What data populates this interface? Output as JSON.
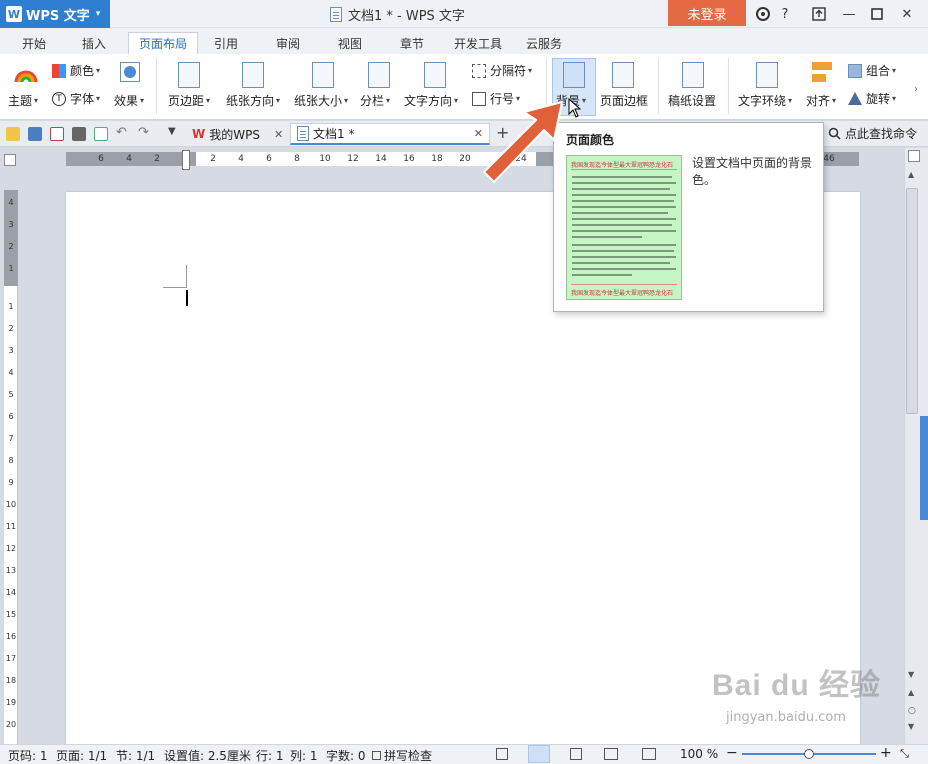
{
  "titlebar": {
    "app_name": "WPS 文字",
    "app_logo": "W",
    "doc_title": "文档1 * - WPS 文字",
    "login": "未登录",
    "skin_icon": "skin-icon",
    "help": "?",
    "minimize": "—",
    "close": "✕"
  },
  "tabs": [
    "开始",
    "插入",
    "页面布局",
    "引用",
    "审阅",
    "视图",
    "章节",
    "开发工具",
    "云服务"
  ],
  "active_tab": "页面布局",
  "ribbon": {
    "theme": "主题",
    "color": "颜色",
    "font": "字体",
    "effect": "效果",
    "margins": "页边距",
    "orientation": "纸张方向",
    "size": "纸张大小",
    "columns": "分栏",
    "text_direction": "文字方向",
    "separator": "分隔符",
    "line_number": "行号",
    "background": "背景",
    "page_border": "页面边框",
    "paper_settings": "稿纸设置",
    "text_wrap": "文字环绕",
    "align": "对齐",
    "group": "组合",
    "rotate": "旋转"
  },
  "qab": {
    "tab1": "我的WPS",
    "tab2": "文档1 *",
    "search": "点此查找命令",
    "add": "+"
  },
  "ruler": {
    "h_ticks": [
      "6",
      "4",
      "2",
      "2",
      "4",
      "6",
      "8",
      "10",
      "12",
      "14",
      "16",
      "18",
      "20",
      "24",
      "46"
    ],
    "v_ticks": [
      "4",
      "3",
      "2",
      "1",
      "1",
      "2",
      "3",
      "4",
      "5",
      "6",
      "7",
      "8",
      "9",
      "10",
      "11",
      "12",
      "13",
      "14",
      "15",
      "16",
      "17",
      "18",
      "19",
      "20",
      "21",
      "22"
    ]
  },
  "popup": {
    "title": "页面颜色",
    "description": "设置文档中页面的背景色。",
    "preview_bg": "#c6f5c6",
    "preview_head": "我国发现迄今体型最大翠冠鸭恐龙化石"
  },
  "status": {
    "page_num": "页码: 1",
    "pages": "页面: 1/1",
    "section": "节: 1/1",
    "setting": "设置值: 2.5厘米",
    "row": "行: 1",
    "col": "列: 1",
    "words": "字数: 0",
    "spell": "拼写检查",
    "zoom": "100 %",
    "zoom_level": 0.5
  },
  "colors": {
    "accent": "#2e7ed1",
    "login": "#e36a43",
    "arrow": "#e0603a",
    "preview_green": "#c6f5c6"
  },
  "watermark": {
    "brand": "Bai du 经验",
    "url": "jingyan.baidu.com"
  }
}
